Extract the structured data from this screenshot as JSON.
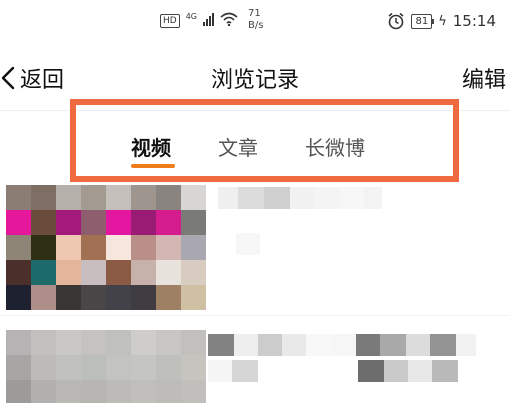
{
  "status_bar": {
    "hd": "HD",
    "network": "4G",
    "speed_value": "71",
    "speed_unit": "B/s",
    "battery": "81",
    "time": "15:14"
  },
  "header": {
    "back_label": "返回",
    "title": "浏览记录",
    "edit_label": "编辑"
  },
  "tabs": [
    {
      "label": "视频",
      "active": true
    },
    {
      "label": "文章",
      "active": false
    },
    {
      "label": "长微博",
      "active": false
    }
  ],
  "colors": {
    "accent": "#f07b1b",
    "highlight_border": "#f06a3f"
  },
  "icons": [
    "hd-icon",
    "signal-icon",
    "wifi-icon",
    "alarm-icon",
    "battery-icon",
    "charging-icon",
    "back-chevron-icon"
  ]
}
